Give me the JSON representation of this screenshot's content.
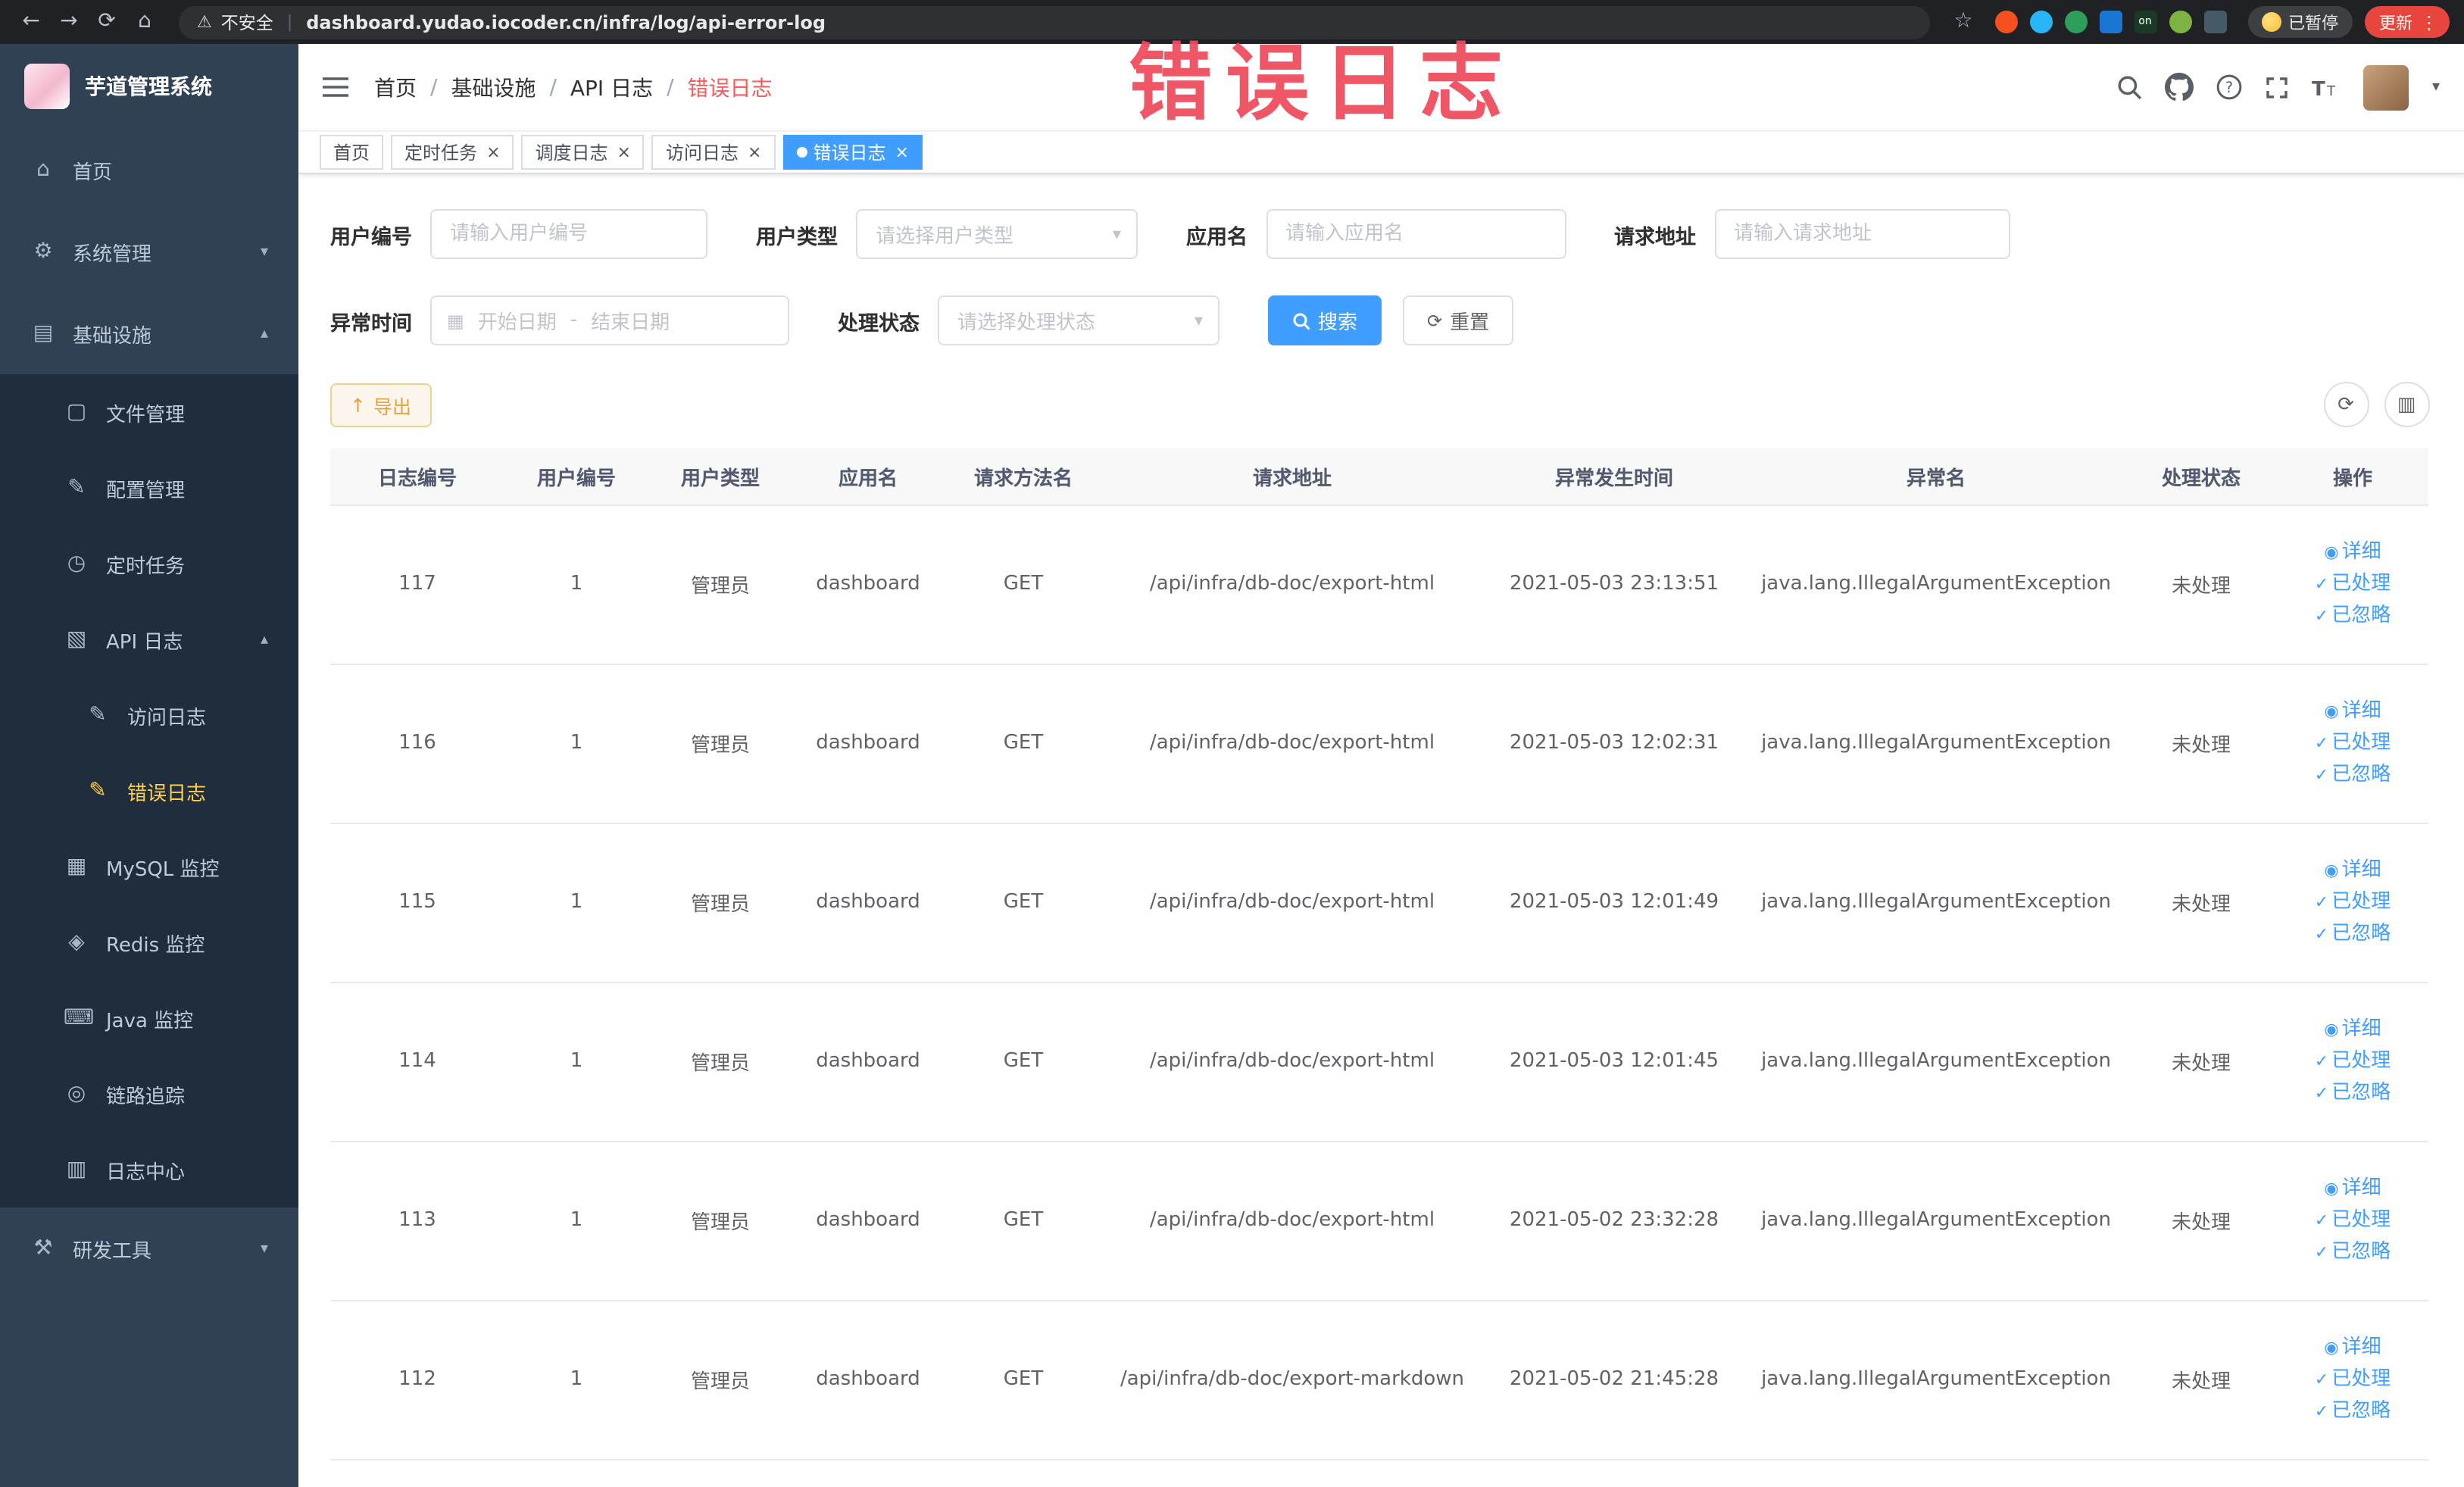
{
  "colors": {
    "accent": "#409eff",
    "link": "#409eff",
    "tag-active": "#409eff",
    "menu-bg": "#304156",
    "submenu-bg": "#1f2d3d",
    "menu-text": "#bfcbd9",
    "menu-active": "#ffd04b",
    "warning-text": "#e6a23c",
    "warning-bg": "#fdf6ec",
    "warning-border": "#f0ce94",
    "annotation": "#ee4b5c",
    "chrome-bg": "#202124",
    "chrome-field": "#2e3034",
    "update-red": "#e8453c"
  },
  "icon_glyphs": {
    "home-icon": "⌂",
    "system-icon": "⚙",
    "infra-icon": "▤",
    "file-icon": "▢",
    "config-icon": "✎",
    "cron-icon": "◷",
    "api-log-icon": "▧",
    "access-log-icon": "✎",
    "error-log-icon": "✎",
    "mysql-icon": "▦",
    "redis-icon": "◈",
    "java-icon": "⌨",
    "trace-icon": "◎",
    "log-center-icon": "▥",
    "devtool-icon": "⚒",
    "eye-icon": "◉",
    "check-icon": "✓",
    "refresh-icon": "⟳",
    "columns-icon": "▥",
    "export-icon": "↑",
    "calendar-icon": "▦"
  },
  "browser": {
    "security_label": "不安全",
    "url": "dashboard.yudao.iocoder.cn/infra/log/api-error-log",
    "paused_label": "已暂停",
    "update_label": "更新",
    "extensions": [
      {
        "name": "extension-icon-orange",
        "color": "#f4511e"
      },
      {
        "name": "extension-icon-blue-drop",
        "color": "#29b6f6"
      },
      {
        "name": "extension-icon-green",
        "color": "#2e9e5b"
      },
      {
        "name": "extension-icon-blue-grid",
        "color": "#1976d2",
        "shape": "square"
      },
      {
        "name": "extension-icon-switch-on",
        "color": "#1b3a26",
        "shape": "square",
        "glyph": "on"
      },
      {
        "name": "extension-icon-leaf",
        "color": "#7cb342"
      },
      {
        "name": "extension-icon-paw",
        "color": "#455a64",
        "shape": "square"
      }
    ]
  },
  "annotation": {
    "text": "错误日志"
  },
  "sidebar": {
    "logo_title": "芋道管理系统",
    "menu": [
      {
        "label": "首页",
        "icon": "home-icon",
        "level": 1
      },
      {
        "label": "系统管理",
        "icon": "system-icon",
        "level": 1,
        "chevron": "down"
      },
      {
        "label": "基础设施",
        "icon": "infra-icon",
        "level": 1,
        "chevron": "up"
      },
      {
        "label": "文件管理",
        "icon": "file-icon",
        "level": 2
      },
      {
        "label": "配置管理",
        "icon": "config-icon",
        "level": 2
      },
      {
        "label": "定时任务",
        "icon": "cron-icon",
        "level": 2
      },
      {
        "label": "API 日志",
        "icon": "api-log-icon",
        "level": 2,
        "chevron": "up"
      },
      {
        "label": "访问日志",
        "icon": "access-log-icon",
        "level": 3
      },
      {
        "label": "错误日志",
        "icon": "error-log-icon",
        "level": 3,
        "active": true
      },
      {
        "label": "MySQL 监控",
        "icon": "mysql-icon",
        "level": 2
      },
      {
        "label": "Redis 监控",
        "icon": "redis-icon",
        "level": 2
      },
      {
        "label": "Java 监控",
        "icon": "java-icon",
        "level": 2
      },
      {
        "label": "链路追踪",
        "icon": "trace-icon",
        "level": 2
      },
      {
        "label": "日志中心",
        "icon": "log-center-icon",
        "level": 2
      },
      {
        "label": "研发工具",
        "icon": "devtool-icon",
        "level": 1,
        "chevron": "down"
      }
    ]
  },
  "navbar": {
    "breadcrumb": [
      {
        "label": "首页"
      },
      {
        "label": "基础设施"
      },
      {
        "label": "API 日志"
      },
      {
        "label": "错误日志",
        "current": true
      }
    ]
  },
  "tabs": [
    {
      "label": "首页"
    },
    {
      "label": "定时任务",
      "closable": true
    },
    {
      "label": "调度日志",
      "closable": true
    },
    {
      "label": "访问日志",
      "closable": true
    },
    {
      "label": "错误日志",
      "closable": true,
      "active": true
    }
  ],
  "filters": {
    "user_id": {
      "label": "用户编号",
      "placeholder": "请输入用户编号"
    },
    "user_type": {
      "label": "用户类型",
      "placeholder": "请选择用户类型"
    },
    "app_name": {
      "label": "应用名",
      "placeholder": "请输入应用名"
    },
    "request_url": {
      "label": "请求地址",
      "placeholder": "请输入请求地址"
    },
    "exception_time": {
      "label": "异常时间",
      "start_placeholder": "开始日期",
      "separator": "-",
      "end_placeholder": "结束日期"
    },
    "process_status": {
      "label": "处理状态",
      "placeholder": "请选择处理状态"
    },
    "search_label": "搜索",
    "reset_label": "重置"
  },
  "toolbar": {
    "export_label": "导出"
  },
  "table": {
    "headers": [
      "日志编号",
      "用户编号",
      "用户类型",
      "应用名",
      "请求方法名",
      "请求地址",
      "异常发生时间",
      "异常名",
      "处理状态",
      "操作"
    ],
    "fields": [
      "log_id",
      "user_id",
      "user_type",
      "app_name",
      "method",
      "request_url",
      "exception_time",
      "exception_name",
      "status"
    ],
    "actions": [
      {
        "label": "详细",
        "name": "detail-link",
        "icon": "eye-icon"
      },
      {
        "label": "已处理",
        "name": "mark-processed-link",
        "icon": "check-icon"
      },
      {
        "label": "已忽略",
        "name": "mark-ignored-link",
        "icon": "check-icon"
      }
    ],
    "rows": [
      {
        "log_id": "117",
        "user_id": "1",
        "user_type": "管理员",
        "app_name": "dashboard",
        "method": "GET",
        "request_url": "/api/infra/db-doc/export-html",
        "exception_time": "2021-05-03 23:13:51",
        "exception_name": "java.lang.IllegalArgumentException",
        "status": "未处理"
      },
      {
        "log_id": "116",
        "user_id": "1",
        "user_type": "管理员",
        "app_name": "dashboard",
        "method": "GET",
        "request_url": "/api/infra/db-doc/export-html",
        "exception_time": "2021-05-03 12:02:31",
        "exception_name": "java.lang.IllegalArgumentException",
        "status": "未处理"
      },
      {
        "log_id": "115",
        "user_id": "1",
        "user_type": "管理员",
        "app_name": "dashboard",
        "method": "GET",
        "request_url": "/api/infra/db-doc/export-html",
        "exception_time": "2021-05-03 12:01:49",
        "exception_name": "java.lang.IllegalArgumentException",
        "status": "未处理"
      },
      {
        "log_id": "114",
        "user_id": "1",
        "user_type": "管理员",
        "app_name": "dashboard",
        "method": "GET",
        "request_url": "/api/infra/db-doc/export-html",
        "exception_time": "2021-05-03 12:01:45",
        "exception_name": "java.lang.IllegalArgumentException",
        "status": "未处理"
      },
      {
        "log_id": "113",
        "user_id": "1",
        "user_type": "管理员",
        "app_name": "dashboard",
        "method": "GET",
        "request_url": "/api/infra/db-doc/export-html",
        "exception_time": "2021-05-02 23:32:28",
        "exception_name": "java.lang.IllegalArgumentException",
        "status": "未处理"
      },
      {
        "log_id": "112",
        "user_id": "1",
        "user_type": "管理员",
        "app_name": "dashboard",
        "method": "GET",
        "request_url": "/api/infra/db-doc/export-markdown",
        "exception_time": "2021-05-02 21:45:28",
        "exception_name": "java.lang.IllegalArgumentException",
        "status": "未处理"
      }
    ]
  }
}
